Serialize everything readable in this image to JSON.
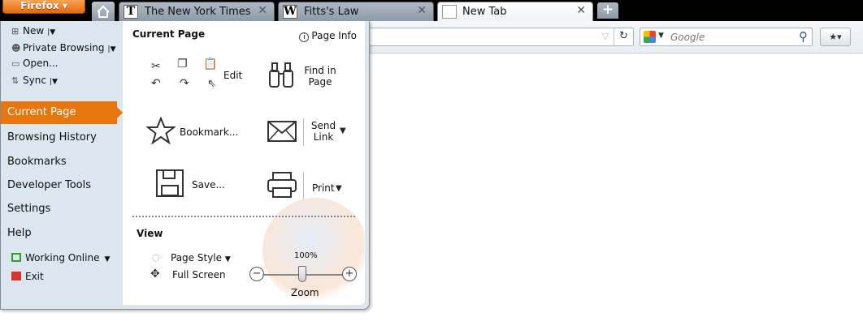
{
  "browser": {
    "app_button_label": "Firefox",
    "tabs": [
      {
        "label": "The New York Times",
        "favicon": "T"
      },
      {
        "label": "Fitts's Law",
        "favicon": "W"
      },
      {
        "label": "New Tab",
        "favicon": ""
      }
    ],
    "search_placeholder": "Google"
  },
  "menu": {
    "top_items": [
      {
        "label": "New",
        "icon": "new-window-icon"
      },
      {
        "label": "Private Browsing",
        "icon": "mask-icon"
      },
      {
        "label": "Open...",
        "icon": "folder-icon"
      },
      {
        "label": "Sync",
        "icon": "sync-icon"
      }
    ],
    "categories": [
      {
        "label": "Current Page",
        "active": true
      },
      {
        "label": "Browsing History"
      },
      {
        "label": "Bookmarks"
      },
      {
        "label": "Developer Tools"
      },
      {
        "label": "Settings"
      },
      {
        "label": "Help"
      }
    ],
    "footer_items": [
      {
        "label": "Working Online",
        "icon": "monitor-icon",
        "color": "#2e9e2e"
      },
      {
        "label": "Exit",
        "icon": "exit-icon",
        "color": "#d9332f"
      }
    ]
  },
  "current_page": {
    "title": "Current Page",
    "page_info": "Page Info",
    "edit": "Edit",
    "find": "Find in Page",
    "bookmark": "Bookmark...",
    "send_link": "Send Link",
    "save": "Save...",
    "print": "Print"
  },
  "view": {
    "title": "View",
    "page_style": "Page Style",
    "full_screen": "Full Screen",
    "zoom_level": "100%",
    "zoom_label": "Zoom"
  },
  "colors": {
    "accent": "#e8760e",
    "panel_bg": "#dbe6ef"
  }
}
